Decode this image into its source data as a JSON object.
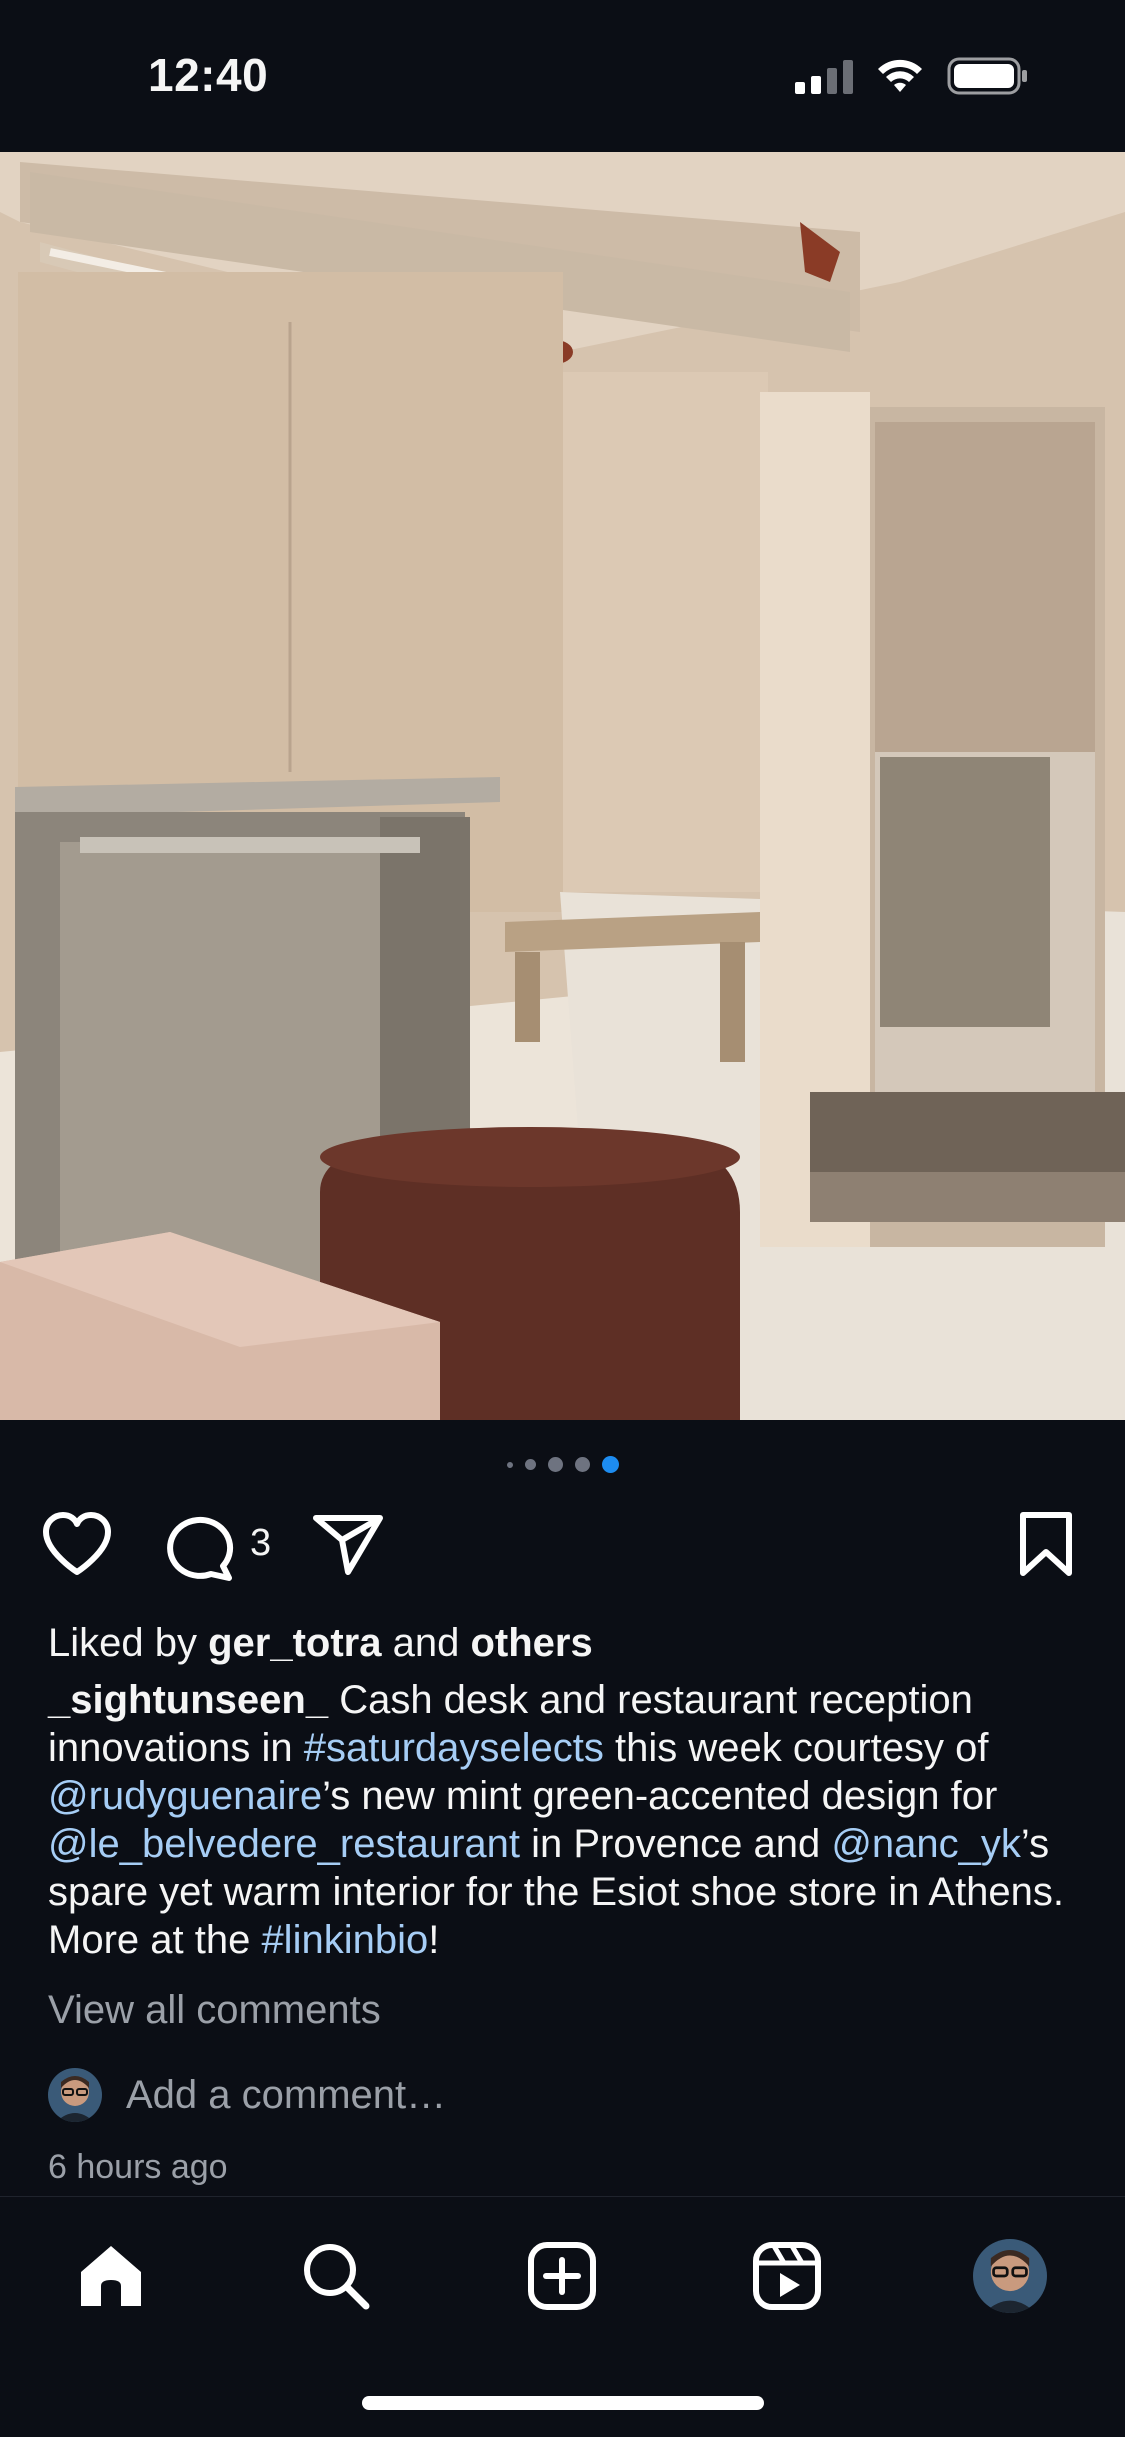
{
  "status_bar": {
    "time": "12:40"
  },
  "carousel": {
    "total": 5,
    "active_index": 4
  },
  "actions": {
    "comment_count": "3"
  },
  "likes": {
    "prefix": "Liked by ",
    "user": "ger_totra",
    "middle": " and ",
    "others": "others"
  },
  "caption": {
    "username": "_sightunseen_",
    "parts": [
      {
        "text": " Cash desk and restaurant reception innovations in ",
        "type": "text"
      },
      {
        "text": "#saturdayselects",
        "type": "tag"
      },
      {
        "text": " this week courtesy of ",
        "type": "text"
      },
      {
        "text": "@rudyguenaire",
        "type": "tag"
      },
      {
        "text": "’s new mint green-accented design for ",
        "type": "text"
      },
      {
        "text": "@le_belvedere_restaurant",
        "type": "tag"
      },
      {
        "text": " in Provence and ",
        "type": "text"
      },
      {
        "text": "@nanc_yk",
        "type": "tag"
      },
      {
        "text": "’s spare yet warm interior for the Esiot shoe store in Athens. More at the ",
        "type": "text"
      },
      {
        "text": "#linkinbio",
        "type": "tag"
      },
      {
        "text": "!",
        "type": "text"
      }
    ]
  },
  "comments": {
    "view_all": "View all comments",
    "placeholder": "Add a comment…"
  },
  "timestamp": "6 hours ago",
  "colors": {
    "background": "#0b0e15",
    "link": "#a6cdf5",
    "active_dot": "#1d8cf0"
  }
}
